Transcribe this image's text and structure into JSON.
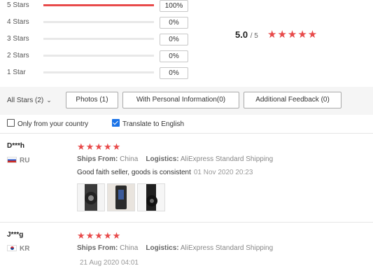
{
  "distribution": [
    {
      "label": "5 Stars",
      "pct_text": "100%",
      "fill": 1.0
    },
    {
      "label": "4 Stars",
      "pct_text": "0%",
      "fill": 0
    },
    {
      "label": "3 Stars",
      "pct_text": "0%",
      "fill": 0
    },
    {
      "label": "2 Stars",
      "pct_text": "0%",
      "fill": 0
    },
    {
      "label": "1 Star",
      "pct_text": "0%",
      "fill": 0
    }
  ],
  "summary": {
    "score": "5.0",
    "out_of": "/ 5",
    "stars": "★★★★★"
  },
  "filters": {
    "all_stars": "All Stars (2)",
    "photos": "Photos (1)",
    "personal_info": "With Personal Information(0)",
    "additional_feedback": "Additional Feedback (0)"
  },
  "options": {
    "only_country": {
      "label": "Only from your country",
      "checked": false
    },
    "translate": {
      "label": "Translate to English",
      "checked": true
    }
  },
  "reviews": [
    {
      "user": "D***h",
      "country": "RU",
      "stars": "★★★★★",
      "ships_from_label": "Ships From:",
      "ships_from": "China",
      "logistics_label": "Logistics:",
      "logistics": "AliExpress Standard Shipping",
      "text": "Good faith seller, goods is consistent",
      "date": "01 Nov 2020 20:23"
    },
    {
      "user": "J***g",
      "country": "KR",
      "stars": "★★★★★",
      "ships_from_label": "Ships From:",
      "ships_from": "China",
      "logistics_label": "Logistics:",
      "logistics": "AliExpress Standard Shipping",
      "text": "",
      "date": "21 Aug 2020 04:01"
    }
  ],
  "colors": {
    "accent": "#e84a4a",
    "checkbox": "#1a73e8"
  }
}
